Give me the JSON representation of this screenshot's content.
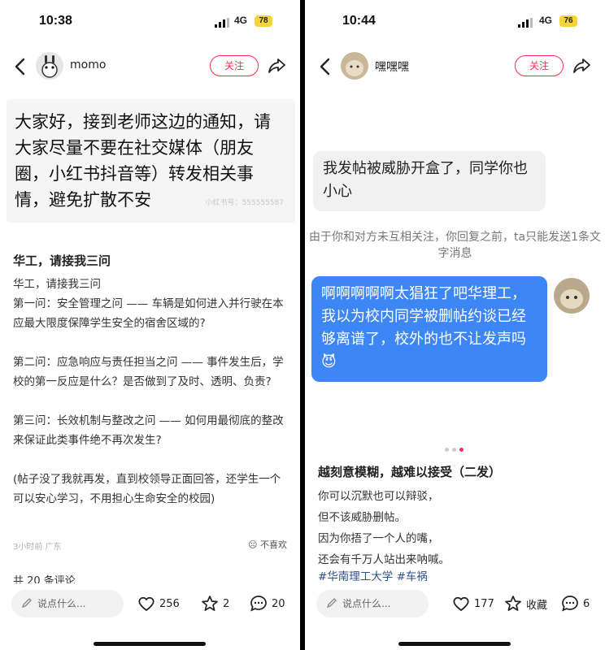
{
  "left": {
    "status": {
      "time": "10:38",
      "network": "4G",
      "battery": "78"
    },
    "nav": {
      "username": "momo",
      "follow_label": "关注"
    },
    "notice": {
      "text": "大家好，接到老师这边的通知，请大家尽量不要在社交媒体（朋友圈，小红书抖音等）转发相关事情，避免扩散不安",
      "watermark": "小红书号：555555587"
    },
    "post": {
      "title": "华工，请接我三问",
      "body": "华工，请接我三问\n第一问：安全管理之问 —— 车辆是如何进入并行驶在本应最大限度保障学生安全的宿舍区域的?\n\n第二问：应急响应与责任担当之问 —— 事件发生后，学校的第一反应是什么？是否做到了及时、透明、负责?\n\n第三问：长效机制与整改之问 —— 如何用最彻底的整改来保证此类事件绝不再次发生?\n\n(帖子没了我就再发，直到校领导正面回答，还学生一个可以安心学习，不用担心生命安全的校园)",
      "meta": "3小时前 广东",
      "dislike": "不喜欢",
      "comment_count": "共 20 条评论"
    },
    "bottom": {
      "placeholder": "说点什么...",
      "likes": "256",
      "stars": "2",
      "comments": "20"
    }
  },
  "right": {
    "status": {
      "time": "10:44",
      "network": "4G",
      "battery": "76"
    },
    "nav": {
      "username": "嘿嘿嘿",
      "follow_label": "关注"
    },
    "chat": {
      "incoming": "我发帖被威胁开盒了，同学你也小心",
      "hint": "由于你和对方未互相关注，你回复之前，ta只能发送1条文字消息",
      "outgoing": "啊啊啊啊啊太猖狂了吧华理工，我以为校内同学被删帖约谈已经够离谱了，校外的也不让发声吗",
      "emoji": "😈"
    },
    "post": {
      "title": "越刻意模糊，越难以接受（二发）",
      "lines": [
        "你可以沉默也可以辩驳，",
        "但不该威胁删帖。",
        "因为你捂了一个人的嘴，",
        "还会有千万人站出来呐喊。"
      ],
      "tags": "#华南理工大学 #车祸"
    },
    "bottom": {
      "placeholder": "说点什么...",
      "likes": "177",
      "stars": "收藏",
      "comments": "6"
    }
  },
  "colors": {
    "accent": "#ff2d4f",
    "bubble_blue": "#3d86f5",
    "tag": "#2d4f8a"
  },
  "icons": [
    "back-icon",
    "share-icon",
    "heart-icon",
    "star-icon",
    "comment-icon",
    "pen-icon",
    "signal-icon",
    "dislike-icon"
  ]
}
